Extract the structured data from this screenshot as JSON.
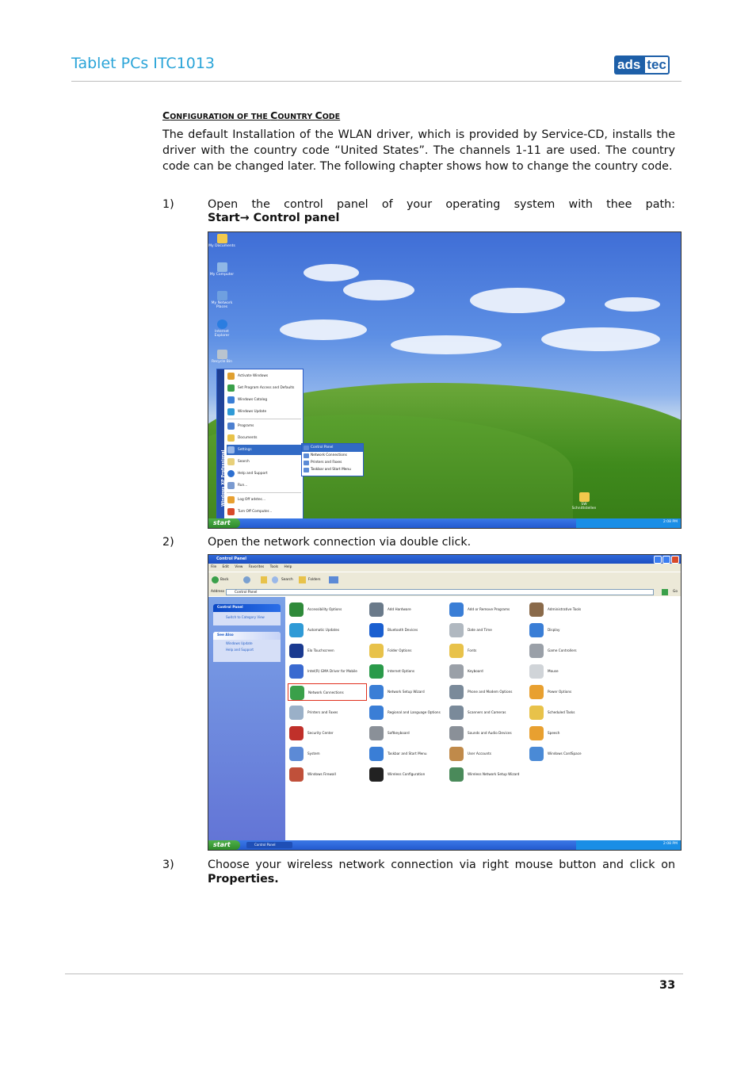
{
  "header": {
    "title": "Tablet PCs ITC1013",
    "logo_left": "ads",
    "logo_right": "tec"
  },
  "section": {
    "heading_first_big": "C",
    "heading_first_small": "ONFIGURATION OF THE ",
    "heading_second_big": "C",
    "heading_second_small": "OUNTRY ",
    "heading_third_big": "C",
    "heading_third_small": "ODE",
    "paragraph": "The default Installation of the WLAN driver, which is provided by Service-CD, installs the driver with the country code “United States”. The channels 1-11 are used. The country code can be changed later. The following chapter shows how to change the country code."
  },
  "steps": [
    {
      "number": "1)",
      "text": "Open the control panel of your operating system with thee path:",
      "bold_start": "Start",
      "arrow": "→",
      "bold_end": " Control panel"
    },
    {
      "number": "2)",
      "text": "Open the network connection via double click."
    },
    {
      "number": "3)",
      "text": "Choose your wireless network connection via right mouse button and click on",
      "bold": "Properties."
    }
  ],
  "desktop_screenshot": {
    "desktop_icons": [
      "My Documents",
      "My Computer",
      "My Network Places",
      "Internet Explorer",
      "Recycle Bin"
    ],
    "folder_icon": "SW Schnittstellen",
    "start_button": "start",
    "sidebar_text": "Windows XP Professional",
    "start_menu_items": [
      "Activate Windows",
      "Set Program Access and Defaults",
      "Windows Catalog",
      "Windows Update",
      "Programs",
      "Documents",
      "Settings",
      "Search",
      "Help and Support",
      "Run...",
      "Log Off adstec...",
      "Turn Off Computer..."
    ],
    "submenu_items": [
      "Control Panel",
      "Network Connections",
      "Printers and Faxes",
      "Taskbar and Start Menu"
    ],
    "clock": "2:08 PM"
  },
  "control_panel_screenshot": {
    "title": "Control Panel",
    "menu": "File Edit View Favorites Tools Help",
    "toolbar_back": "Back",
    "toolbar_search": "Search",
    "toolbar_folders": "Folders",
    "address_label": "Address",
    "address_value": "Control Panel",
    "go": "Go",
    "left_box1_title": "Control Panel",
    "left_box1_link": "Switch to Category View",
    "left_box2_title": "See Also",
    "left_box2_links": [
      "Windows Update",
      "Help and Support"
    ],
    "items": [
      "Accessibility Options",
      "Add Hardware",
      "Add or Remove Programs",
      "Administrative Tools",
      "Automatic Updates",
      "Bluetooth Devices",
      "Date and Time",
      "Display",
      "Elo Touchscreen",
      "Folder Options",
      "Fonts",
      "Game Controllers",
      "Intel(R) GMA Driver for Mobile",
      "Internet Options",
      "Keyboard",
      "Mouse",
      "Network Connections",
      "Network Setup Wizard",
      "Phone and Modem Options",
      "Power Options",
      "Printers and Faxes",
      "Regional and Language Options",
      "Scanners and Cameras",
      "Scheduled Tasks",
      "Security Center",
      "Softkeyboard",
      "Sounds and Audio Devices",
      "Speech",
      "System",
      "Taskbar and Start Menu",
      "User Accounts",
      "Windows CardSpace",
      "Windows Firewall",
      "Wireless Configuration",
      "Wireless Network Setup Wizard"
    ],
    "taskbar_window": "Control Panel",
    "start_button": "start",
    "clock": "2:08 PM"
  },
  "footer": {
    "page_number": "33"
  }
}
